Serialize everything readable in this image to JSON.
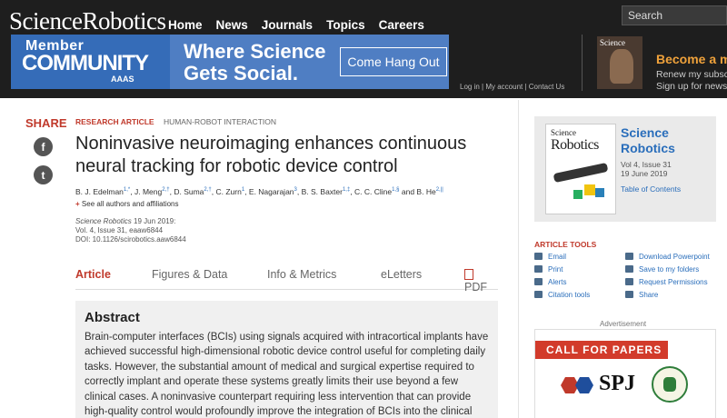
{
  "header": {
    "logo": "ScienceRobotics",
    "nav": [
      "Home",
      "News",
      "Journals",
      "Topics",
      "Careers"
    ],
    "search_placeholder": "Search",
    "account_links": [
      "Log in",
      "My account",
      "Contact Us"
    ]
  },
  "banner": {
    "member": "Member",
    "community": "COMMUNITY",
    "aaas": "AAAS",
    "headline_1": "Where Science",
    "headline_2": "Gets Social.",
    "cta": "Come Hang Out"
  },
  "promo": {
    "cover_title": "Science",
    "become": "Become a mem",
    "renew_1": "Renew my subscripti",
    "renew_2": "Sign up for newslett"
  },
  "share": {
    "label": "SHARE",
    "facebook": "f",
    "twitter": "t"
  },
  "article": {
    "type": "RESEARCH ARTICLE",
    "category": "HUMAN-ROBOT INTERACTION",
    "title": "Noninvasive neuroimaging enhances continuous neural tracking for robotic device control",
    "authors": [
      {
        "name": "B. J. Edelman",
        "sup": "1,*"
      },
      {
        "name": "J. Meng",
        "sup": "2,†"
      },
      {
        "name": "D. Suma",
        "sup": "2,†"
      },
      {
        "name": "C. Zurn",
        "sup": "1"
      },
      {
        "name": "E. Nagarajan",
        "sup": "3"
      },
      {
        "name": "B. S. Baxter",
        "sup": "1,‡"
      },
      {
        "name": "C. C. Cline",
        "sup": "1,§"
      },
      {
        "name": "B. He",
        "sup": "2,||"
      }
    ],
    "authors_and": "and",
    "see_all": "See all authors and affiliations",
    "journal": "Science Robotics",
    "date": "19 Jun 2019:",
    "volume": "Vol. 4, Issue 31, eaaw6844",
    "doi": "DOI: 10.1126/scirobotics.aaw6844"
  },
  "tabs": [
    "Article",
    "Figures & Data",
    "Info & Metrics",
    "eLetters",
    "PDF"
  ],
  "abstract": {
    "heading": "Abstract",
    "text": "Brain-computer interfaces (BCIs) using signals acquired with intracortical implants have achieved successful high-dimensional robotic device control useful for completing daily tasks. However, the substantial amount of medical and surgical expertise required to correctly implant and operate these systems greatly limits their use beyond a few clinical cases. A noninvasive counterpart requiring less intervention that can provide high-quality control would profoundly improve the integration of BCIs into the clinical and home setting. Here, we present"
  },
  "journal_card": {
    "cover_small": "Science",
    "cover_big": "Robotics",
    "name": "Science Robotics",
    "vol": "Vol 4, Issue 31",
    "date": "19 June 2019",
    "toc": "Table of Contents"
  },
  "tools": {
    "heading": "ARTICLE TOOLS",
    "left": [
      "Email",
      "Print",
      "Alerts",
      "Citation tools"
    ],
    "right": [
      "Download Powerpoint",
      "Save to my folders",
      "Request Permissions",
      "Share"
    ]
  },
  "ad": {
    "label": "Advertisement",
    "call": "CALL FOR PAPERS",
    "brand": "SPJ"
  },
  "colors": {
    "accent_red": "#c0392b",
    "link_blue": "#2a6ebb",
    "header_bg": "#1e1e1e",
    "banner_blue": "#4f7ec3",
    "promo_orange": "#f0a23b"
  }
}
